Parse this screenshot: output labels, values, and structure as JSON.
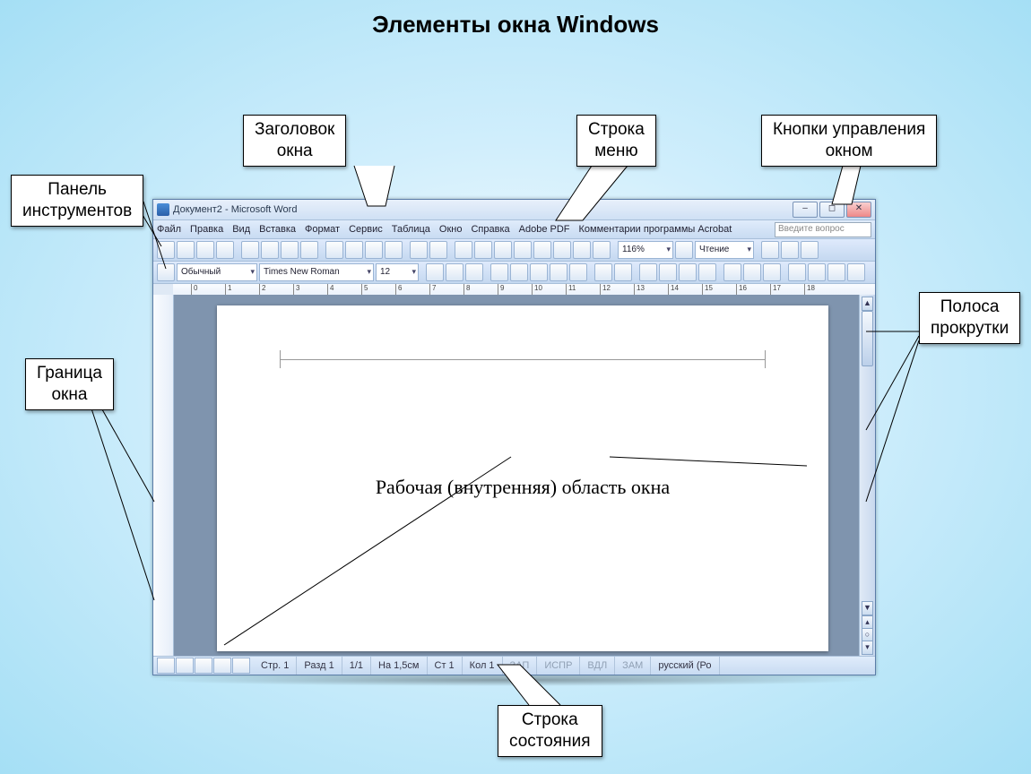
{
  "slide_title": "Элементы окна Windows",
  "callouts": {
    "title_bar": "Заголовок\nокна",
    "menu_bar": "Строка\nменю",
    "window_controls": "Кнопки управления\nокном",
    "toolbar": "Панель\nинструментов",
    "scrollbar": "Полоса\nпрокрутки",
    "border": "Граница\nокна",
    "status_bar": "Строка\nсостояния"
  },
  "window": {
    "title": "Документ2 - Microsoft Word",
    "ask_placeholder": "Введите вопрос",
    "menu": [
      "Файл",
      "Правка",
      "Вид",
      "Вставка",
      "Формат",
      "Сервис",
      "Таблица",
      "Окно",
      "Справка",
      "Adobe PDF",
      "Комментарии программы Acrobat"
    ],
    "zoom": "116%",
    "reading": "Чтение",
    "style": "Обычный",
    "font": "Times New Roman",
    "size": "12",
    "workspace_text": "Рабочая (внутренняя) область окна",
    "status": {
      "page": "Стр. 1",
      "section": "Разд 1",
      "pages": "1/1",
      "at": "На 1,5см",
      "line": "Ст 1",
      "col": "Кол 1",
      "rec": "ЗАП",
      "trk": "ИСПР",
      "ext": "ВДЛ",
      "ovr": "ЗАМ",
      "lang": "русский (Ро"
    }
  }
}
